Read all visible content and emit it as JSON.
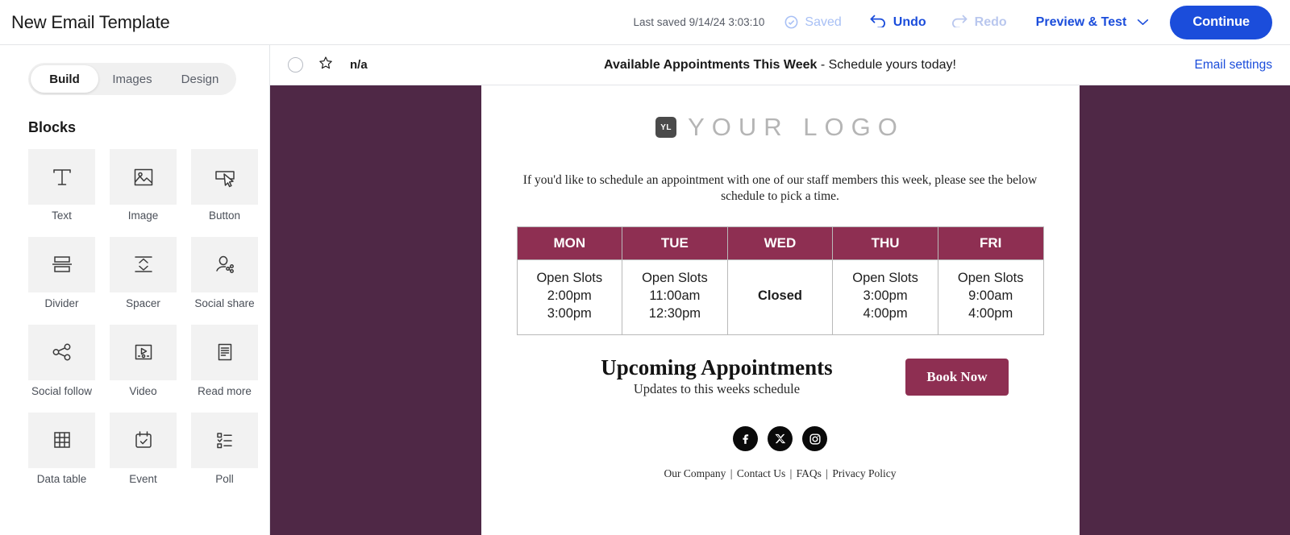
{
  "topbar": {
    "doc_title": "New Email Template",
    "last_saved": "Last saved 9/14/24 3:03:10",
    "saved_label": "Saved",
    "undo_label": "Undo",
    "redo_label": "Redo",
    "preview_test_label": "Preview & Test",
    "continue_label": "Continue",
    "accent_color": "#1b4ddb"
  },
  "sidebar": {
    "tabs": [
      {
        "label": "Build",
        "active": true
      },
      {
        "label": "Images",
        "active": false
      },
      {
        "label": "Design",
        "active": false
      }
    ],
    "section_title": "Blocks",
    "blocks": [
      {
        "label": "Text",
        "icon": "text-icon"
      },
      {
        "label": "Image",
        "icon": "image-icon"
      },
      {
        "label": "Button",
        "icon": "button-icon"
      },
      {
        "label": "Divider",
        "icon": "divider-icon"
      },
      {
        "label": "Spacer",
        "icon": "spacer-icon"
      },
      {
        "label": "Social share",
        "icon": "social-share-icon"
      },
      {
        "label": "Social follow",
        "icon": "social-follow-icon"
      },
      {
        "label": "Video",
        "icon": "video-icon"
      },
      {
        "label": "Read more",
        "icon": "read-more-icon"
      },
      {
        "label": "Data table",
        "icon": "data-table-icon"
      },
      {
        "label": "Event",
        "icon": "event-icon"
      },
      {
        "label": "Poll",
        "icon": "poll-icon"
      }
    ]
  },
  "preview_header": {
    "from_value": "n/a",
    "subject": "Available Appointments This Week",
    "preheader": " - Schedule yours today!",
    "email_settings_label": "Email settings"
  },
  "email": {
    "background_color": "#4f2846",
    "brand_color": "#8e2f52",
    "logo_mark": "YL",
    "logo_text": "YOUR  LOGO",
    "intro": "If you'd like to schedule an appointment with one of our staff members this week, please see the below schedule to pick a time.",
    "schedule": {
      "days": [
        "MON",
        "TUE",
        "WED",
        "THU",
        "FRI"
      ],
      "cells": [
        {
          "title": "Open Slots",
          "times": [
            "2:00pm",
            "3:00pm"
          ],
          "closed": false
        },
        {
          "title": "Open Slots",
          "times": [
            "11:00am",
            "12:30pm"
          ],
          "closed": false
        },
        {
          "title": "Closed",
          "times": [],
          "closed": true
        },
        {
          "title": "Open Slots",
          "times": [
            "3:00pm",
            "4:00pm"
          ],
          "closed": false
        },
        {
          "title": "Open Slots",
          "times": [
            "9:00am",
            "4:00pm"
          ],
          "closed": false
        }
      ]
    },
    "upcoming_heading": "Upcoming Appointments",
    "upcoming_sub": "Updates to this weeks schedule",
    "cta_label": "Book Now",
    "social": [
      {
        "name": "facebook-icon"
      },
      {
        "name": "x-twitter-icon"
      },
      {
        "name": "instagram-icon"
      }
    ],
    "footer_links": [
      "Our Company",
      "Contact Us",
      "FAQs",
      "Privacy Policy"
    ],
    "footer_separator": "|"
  }
}
